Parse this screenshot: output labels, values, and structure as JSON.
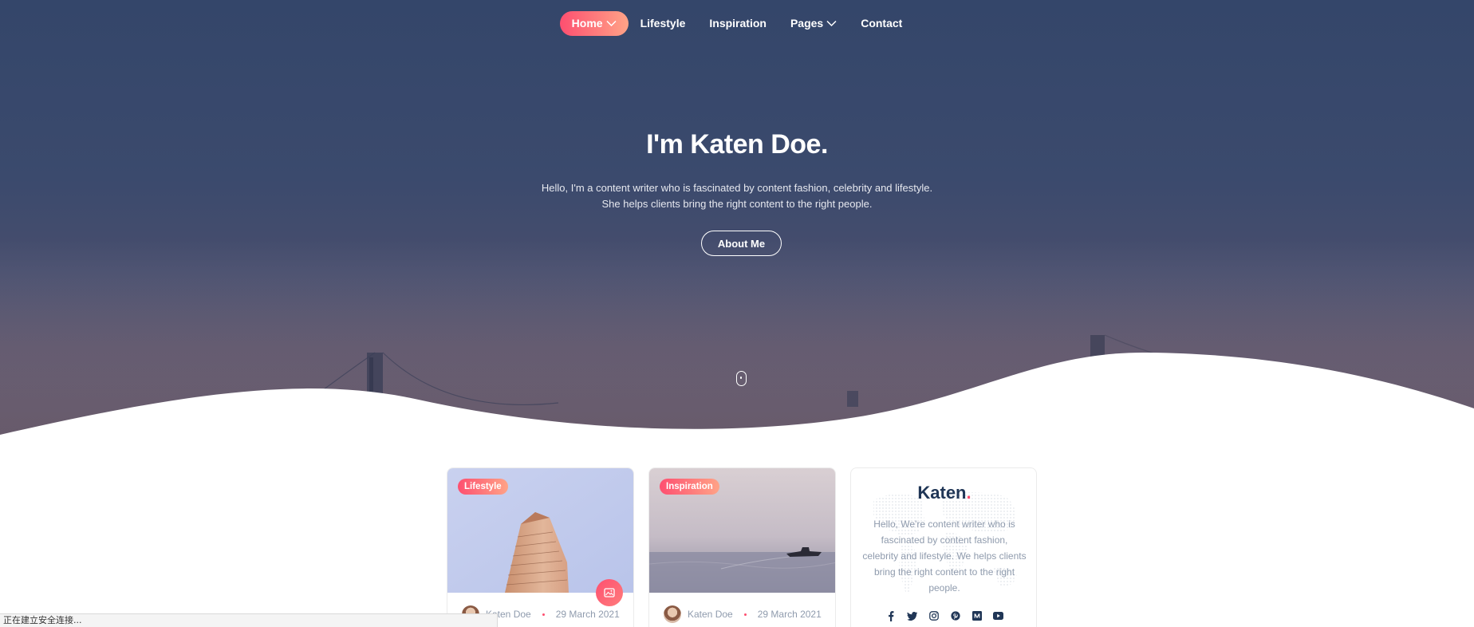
{
  "nav": {
    "items": [
      {
        "label": "Home",
        "active": true,
        "dropdown": true
      },
      {
        "label": "Lifestyle",
        "active": false,
        "dropdown": false
      },
      {
        "label": "Inspiration",
        "active": false,
        "dropdown": false
      },
      {
        "label": "Pages",
        "active": false,
        "dropdown": true
      },
      {
        "label": "Contact",
        "active": false,
        "dropdown": false
      }
    ]
  },
  "hero": {
    "title": "I'm Katen Doe.",
    "subtitle_line1": "Hello, I'm a content writer who is fascinated by content fashion, celebrity and lifestyle.",
    "subtitle_line2": "She helps clients bring the right content to the right people.",
    "button_label": "About Me"
  },
  "posts": [
    {
      "category": "Lifestyle",
      "author": "Katen Doe",
      "date": "29 March 2021",
      "format_icon": "image-icon"
    },
    {
      "category": "Inspiration",
      "author": "Katen Doe",
      "date": "29 March 2021"
    }
  ],
  "widget": {
    "logo_text": "Katen",
    "logo_dot": ".",
    "description": "Hello, We're content writer who is fascinated by content fashion, celebrity and lifestyle. We helps clients bring the right content to the right people.",
    "socials": [
      "facebook-icon",
      "twitter-icon",
      "instagram-icon",
      "pinterest-icon",
      "medium-icon",
      "youtube-icon"
    ]
  },
  "status_bar": {
    "text": "正在建立安全连接..."
  },
  "colors": {
    "accent_start": "#fe4f70",
    "accent_end": "#ffa387",
    "heading": "#203656",
    "muted": "#8f9bad"
  }
}
